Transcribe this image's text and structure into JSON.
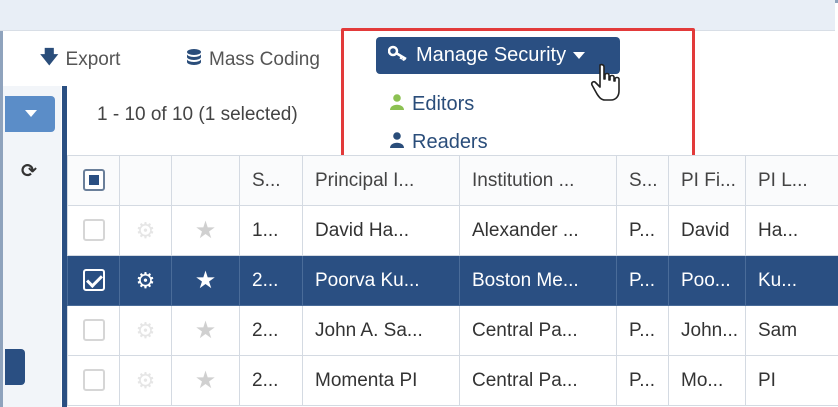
{
  "toolbar": {
    "export_label": "Export",
    "mass_coding_label": "Mass Coding",
    "manage_security_label": "Manage Security",
    "icons": {
      "export": "download-arrow-icon",
      "mass_coding": "database-icon",
      "manage_security": "key-icon"
    }
  },
  "dropdown": {
    "items": [
      {
        "label": "Editors",
        "icon": "user-icon",
        "icon_color": "#8cc152"
      },
      {
        "label": "Readers",
        "icon": "user-icon",
        "icon_color": "#2a4d7a"
      }
    ]
  },
  "pager": {
    "text": "1 - 10 of 10 (1 selected)"
  },
  "grid": {
    "columns": [
      "S...",
      "Principal I...",
      "Institution ...",
      "S...",
      "PI Fi...",
      "PI L..."
    ],
    "rows": [
      {
        "selected": false,
        "cells": [
          "1...",
          "David Ha...",
          "Alexander ...",
          "P...",
          "David",
          "Ha..."
        ]
      },
      {
        "selected": true,
        "cells": [
          "2...",
          "Poorva Ku...",
          "Boston Me...",
          "P...",
          "Poo...",
          "Ku..."
        ]
      },
      {
        "selected": false,
        "cells": [
          "2...",
          "John A. Sa...",
          "Central Pa...",
          "P...",
          "John...",
          "Sam"
        ]
      },
      {
        "selected": false,
        "cells": [
          "2...",
          "Momenta PI",
          "Central Pa...",
          "P...",
          "Mo...",
          "PI"
        ]
      }
    ]
  },
  "colors": {
    "accent": "#2a4f82",
    "highlight_box": "#e23a3a",
    "side_button": "#5b8dc8"
  }
}
